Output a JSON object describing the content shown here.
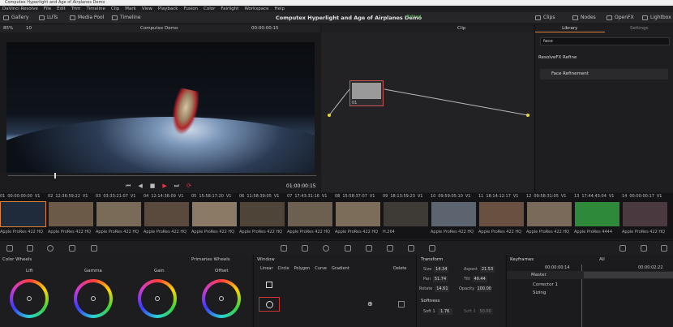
{
  "window": {
    "title": "Computex Hyperlight and Age of Airplanes Demo"
  },
  "menu": [
    "DaVinci Resolve",
    "File",
    "Edit",
    "Trim",
    "Timeline",
    "Clip",
    "Mark",
    "View",
    "Playback",
    "Fusion",
    "Color",
    "Fairlight",
    "Workspace",
    "Help"
  ],
  "pagebar": {
    "gallery": "Gallery",
    "luts": "LUTs",
    "media_pool": "Media Pool",
    "timeline": "Timeline",
    "project_title": "Computex Hyperlight and Age of Airplanes Demo",
    "status": "Edited",
    "clips": "Clips",
    "nodes": "Nodes",
    "openfx": "OpenFX",
    "lightbox": "Lightbox"
  },
  "viewer": {
    "zoom": "85%",
    "quality": "10",
    "clip_name": "Computex Demo",
    "timecode_top": "00:00:00:15",
    "timecode": "01:00:00:15"
  },
  "node_editor": {
    "mode": "Clip",
    "node_label": "01"
  },
  "library": {
    "tab_active": "Library",
    "tab_other": "Settings",
    "search_value": "face",
    "category": "ResolveFX Refine",
    "item": "Face Refinement"
  },
  "clips": [
    {
      "num": "01",
      "tc": "00:00:00:00",
      "track": "V1",
      "codec": "Apple ProRes 422 HQ",
      "color": "#1f2a3a"
    },
    {
      "num": "02",
      "tc": "12:36:59:22",
      "track": "V1",
      "codec": "Apple ProRes 422 HQ",
      "color": "#6b5a48"
    },
    {
      "num": "03",
      "tc": "03:33:21:07",
      "track": "V1",
      "codec": "Apple ProRes 422 HQ",
      "color": "#7a6a58"
    },
    {
      "num": "04",
      "tc": "12:14:36:09",
      "track": "V1",
      "codec": "Apple ProRes 422 HQ",
      "color": "#5a4a3e"
    },
    {
      "num": "05",
      "tc": "15:58:17:20",
      "track": "V1",
      "codec": "Apple ProRes 422 HQ",
      "color": "#8a7a66"
    },
    {
      "num": "06",
      "tc": "11:58:39:05",
      "track": "V1",
      "codec": "Apple ProRes 422 HQ",
      "color": "#4e4438"
    },
    {
      "num": "07",
      "tc": "17:43:31:16",
      "track": "V1",
      "codec": "Apple ProRes 422 HQ",
      "color": "#6e6050"
    },
    {
      "num": "08",
      "tc": "15:58:37:07",
      "track": "V1",
      "codec": "Apple ProRes 422 HQ",
      "color": "#7c6c5a"
    },
    {
      "num": "09",
      "tc": "18:13:59:23",
      "track": "V1",
      "codec": "H.264",
      "color": "#3e3a36"
    },
    {
      "num": "10",
      "tc": "09:59:05:10",
      "track": "V1",
      "codec": "Apple ProRes 422 HQ",
      "color": "#5c6470"
    },
    {
      "num": "11",
      "tc": "18:14:12:17",
      "track": "V1",
      "codec": "Apple ProRes 422 HQ",
      "color": "#6a5040"
    },
    {
      "num": "12",
      "tc": "09:58:31:05",
      "track": "V1",
      "codec": "Apple ProRes 422 HQ",
      "color": "#7a6a5a"
    },
    {
      "num": "13",
      "tc": "17:44:43:04",
      "track": "V1",
      "codec": "Apple ProRes 4444",
      "color": "#2e8a3a"
    },
    {
      "num": "14",
      "tc": "00:00:00:17",
      "track": "V1",
      "codec": "Apple ProRes 422 HQ",
      "color": "#4a3a40"
    }
  ],
  "color_wheels": {
    "title": "Color Wheels",
    "mode": "Primaries Wheels",
    "wheels": [
      "Lift",
      "Gamma",
      "Gain",
      "Offset"
    ]
  },
  "window_panel": {
    "title": "Window",
    "tools": [
      "Linear",
      "Circle",
      "Polygon",
      "Curve",
      "Gradient"
    ],
    "delete": "Delete"
  },
  "transform": {
    "title": "Transform",
    "size": "14.34",
    "aspect": "21.53",
    "pan": "51.74",
    "tilt": "49.44",
    "rotate": "14.61",
    "opacity": "100.00",
    "softness_title": "Softness",
    "soft1": "1.76",
    "soft2_label": "Soft 2",
    "soft2": "50.00"
  },
  "keyframes": {
    "title": "Keyframes",
    "filter": "All",
    "tc_start": "00:00:00:14",
    "tc_end": "00:00:02:22",
    "rows": [
      "Master",
      "Corrector 1",
      "Sizing"
    ]
  }
}
